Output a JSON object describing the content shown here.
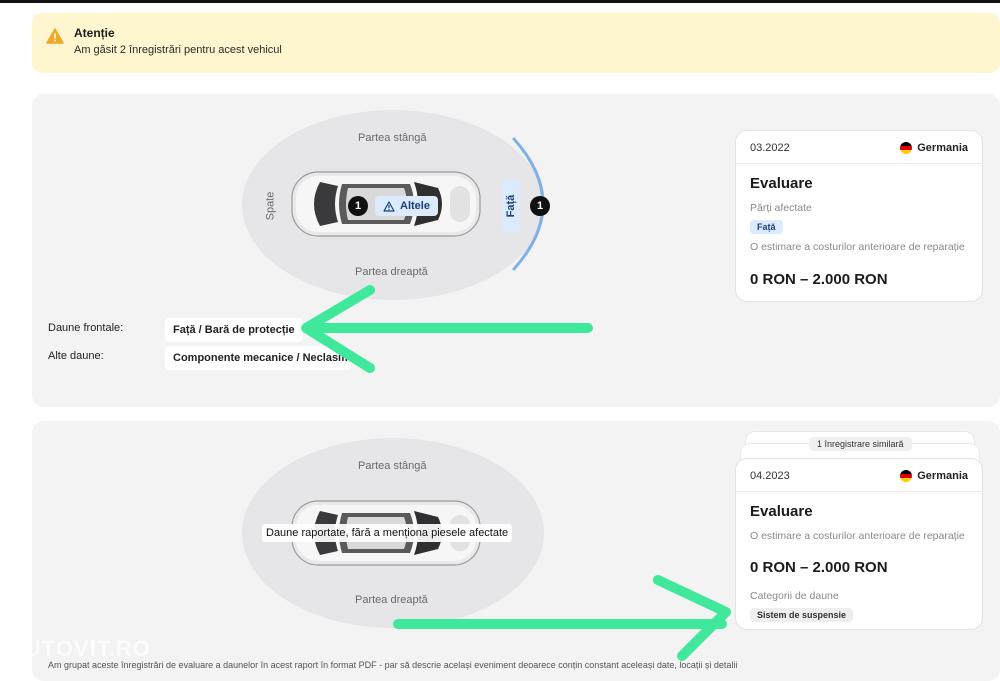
{
  "alert": {
    "title": "Atenție",
    "message": "Am găsit 2 înregistrări pentru acest vehicul"
  },
  "record1": {
    "diagram": {
      "left_label": "Partea stângă",
      "right_label": "Partea dreaptă",
      "back_label": "Spate",
      "front_label": "Față",
      "center_chip": "Altele",
      "center_count": "1",
      "front_count": "1"
    },
    "damages": [
      {
        "label": "Daune frontale:",
        "value": "Față / Bară de protecție"
      },
      {
        "label": "Alte daune:",
        "value": "Componente mecanice / Neclasific"
      }
    ],
    "card": {
      "date": "03.2022",
      "country": "Germania",
      "title": "Evaluare",
      "affected_label": "Părți afectate",
      "affected_tag": "Față",
      "estimate_label": "O estimare a costurilor anterioare de reparație",
      "price": "0 RON – 2.000 RON"
    }
  },
  "record2": {
    "similar_badge": "1 înregistrare similară",
    "diagram": {
      "left_label": "Partea stângă",
      "right_label": "Partea dreaptă",
      "tooltip": "Daune raportate, fără a menționa piesele afectate"
    },
    "card": {
      "date": "04.2023",
      "country": "Germania",
      "title": "Evaluare",
      "estimate_label": "O estimare a costurilor anterioare de reparație",
      "price": "0 RON – 2.000 RON",
      "category_label": "Categorii de daune",
      "category_tag": "Sistem de suspensie"
    }
  },
  "watermark": "AUTOVIT.RO",
  "footnote": "Am grupat aceste înregistrări de evaluare a daunelor în acest raport în format PDF - par să descrie același eveniment deoarece conțin constant aceleași date, locații și detalii",
  "colors": {
    "alert_bg": "#fdf6cf",
    "warning_icon": "#f0a82a",
    "chip_blue": "#dbeafc",
    "arc_blue": "#7fb0e6",
    "annotation_green": "#3fe89a"
  },
  "icons": [
    "warning-icon",
    "alert-triangle-icon",
    "flag-germany-icon",
    "annotation-arrow"
  ]
}
